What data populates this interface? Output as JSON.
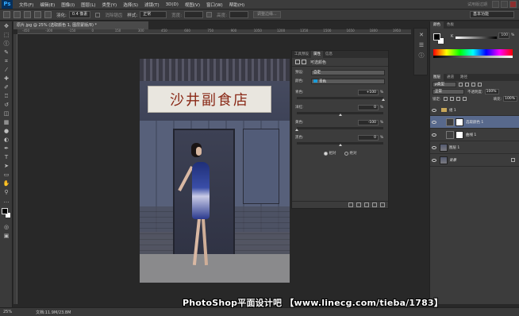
{
  "app": {
    "logo": "Ps",
    "window_title": "试用版过期"
  },
  "menu": [
    "文件(F)",
    "编辑(E)",
    "图像(I)",
    "图层(L)",
    "类型(Y)",
    "选择(S)",
    "滤镜(T)",
    "3D(D)",
    "视图(V)",
    "窗口(W)",
    "帮助(H)"
  ],
  "options": {
    "feather_label": "羽化:",
    "feather_value": "0.4 像素",
    "antialias_label": "消除锯齿",
    "style_label": "样式:",
    "style_value": "正常",
    "width_label": "宽度:",
    "height_label": "高度:",
    "refine_label": "调整边缘...",
    "workspace": "基本功能"
  },
  "document": {
    "tab_title": "原片.jpg @ 25% (选取颜色 1, 图层蒙版/8) *",
    "ruler_ticks": [
      "-450",
      "-300",
      "-150",
      "0",
      "150",
      "300",
      "450",
      "600",
      "750",
      "900",
      "1050",
      "1200",
      "1350",
      "1500",
      "1650",
      "1800",
      "1950"
    ],
    "sign_text": "沙井副食店"
  },
  "properties": {
    "tabs": [
      "工具预设",
      "属性",
      "信息"
    ],
    "active_tab": 1,
    "title": "可选颜色",
    "preset_label": "预设:",
    "preset_value": "自定",
    "colors_label": "颜色:",
    "colors_value": "青色",
    "sliders": [
      {
        "label": "青色:",
        "value": "+100",
        "unit": "%",
        "level": 100
      },
      {
        "label": "洋红:",
        "value": "0",
        "unit": "%",
        "level": 0
      },
      {
        "label": "黄色:",
        "value": "-100",
        "unit": "%",
        "level": -100
      },
      {
        "label": "黑色:",
        "value": "0",
        "unit": "%",
        "level": 0
      }
    ],
    "method_relative": "相对",
    "method_absolute": "绝对"
  },
  "color_panel": {
    "tabs": [
      "颜色",
      "色板"
    ],
    "k_label": "K",
    "k_value": "100",
    "k_unit": "%"
  },
  "layers_panel": {
    "tabs": [
      "图层",
      "通道",
      "路径"
    ],
    "kind_label": "ρ类型",
    "blend_mode": "正常",
    "opacity_label": "不透明度:",
    "opacity_value": "100%",
    "lock_label": "锁定:",
    "fill_label": "填充:",
    "fill_value": "100%",
    "layers": [
      {
        "name": "组 1",
        "type": "group"
      },
      {
        "name": "选取颜色 1",
        "type": "adjustment",
        "selected": true
      },
      {
        "name": "曲线 1",
        "type": "adjustment"
      },
      {
        "name": "图层 1",
        "type": "pixel"
      },
      {
        "name": "背景",
        "type": "background"
      }
    ]
  },
  "status": {
    "zoom": "25%",
    "doc_info": "文档:11.9M/23.8M"
  },
  "watermark": "PhotoShop平面设计吧 【www.linecg.com/tieba/1783】"
}
